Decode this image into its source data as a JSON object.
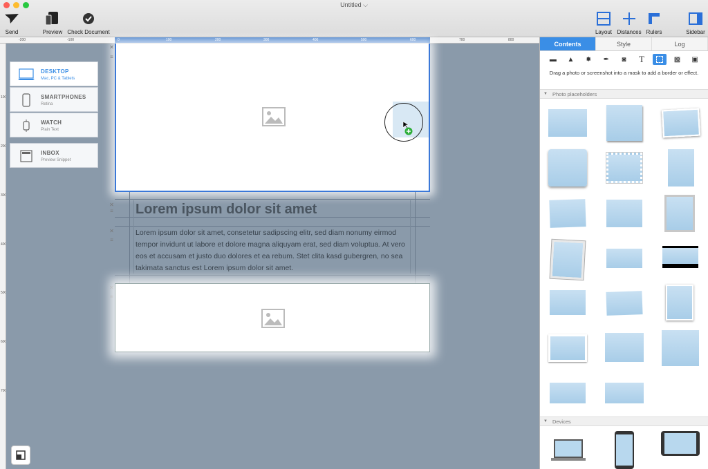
{
  "window": {
    "title": "Untitled"
  },
  "toolbar": {
    "send": "Send",
    "preview": "Preview",
    "check_document": "Check Document",
    "layout": "Layout",
    "distances": "Distances",
    "rulers": "Rulers",
    "sidebar": "Sidebar"
  },
  "ruler": {
    "top_ticks": [
      "-200",
      "-100",
      "0",
      "100",
      "200",
      "300",
      "400",
      "500",
      "600",
      "700",
      "800"
    ],
    "left_ticks": [
      "100",
      "200",
      "300",
      "400",
      "500",
      "600",
      "700"
    ]
  },
  "devices": [
    {
      "name": "DESKTOP",
      "sub": "Mac, PC & Tablets",
      "active": true
    },
    {
      "name": "SMARTPHONES",
      "sub": "Retina",
      "active": false
    },
    {
      "name": "WATCH",
      "sub": "Plain Text",
      "active": false
    },
    {
      "name": "INBOX",
      "sub": "Preview Snippet",
      "active": false
    }
  ],
  "canvas": {
    "heading": "Lorem ipsum dolor sit amet",
    "paragraph": "Lorem ipsum dolor sit amet, consetetur sadipscing elitr, sed diam nonumy eirmod tempor invidunt ut labore et dolore magna aliquyam erat, sed diam voluptua. At vero eos et accusam et justo duo dolores et ea rebum. Stet clita kasd gubergren, no sea takimata sanctus est Lorem ipsum dolor sit amet."
  },
  "sidebar": {
    "tabs": [
      "Contents",
      "Style",
      "Log"
    ],
    "active_tab": "Contents",
    "hint": "Drag a photo or screenshot into a mask to add a border or effect.",
    "section_photos": "Photo placeholders",
    "section_devices": "Devices"
  },
  "colors": {
    "accent": "#3a8ee6",
    "canvas_bg": "#8a9aaa",
    "placeholder": "#b8d8ee"
  }
}
